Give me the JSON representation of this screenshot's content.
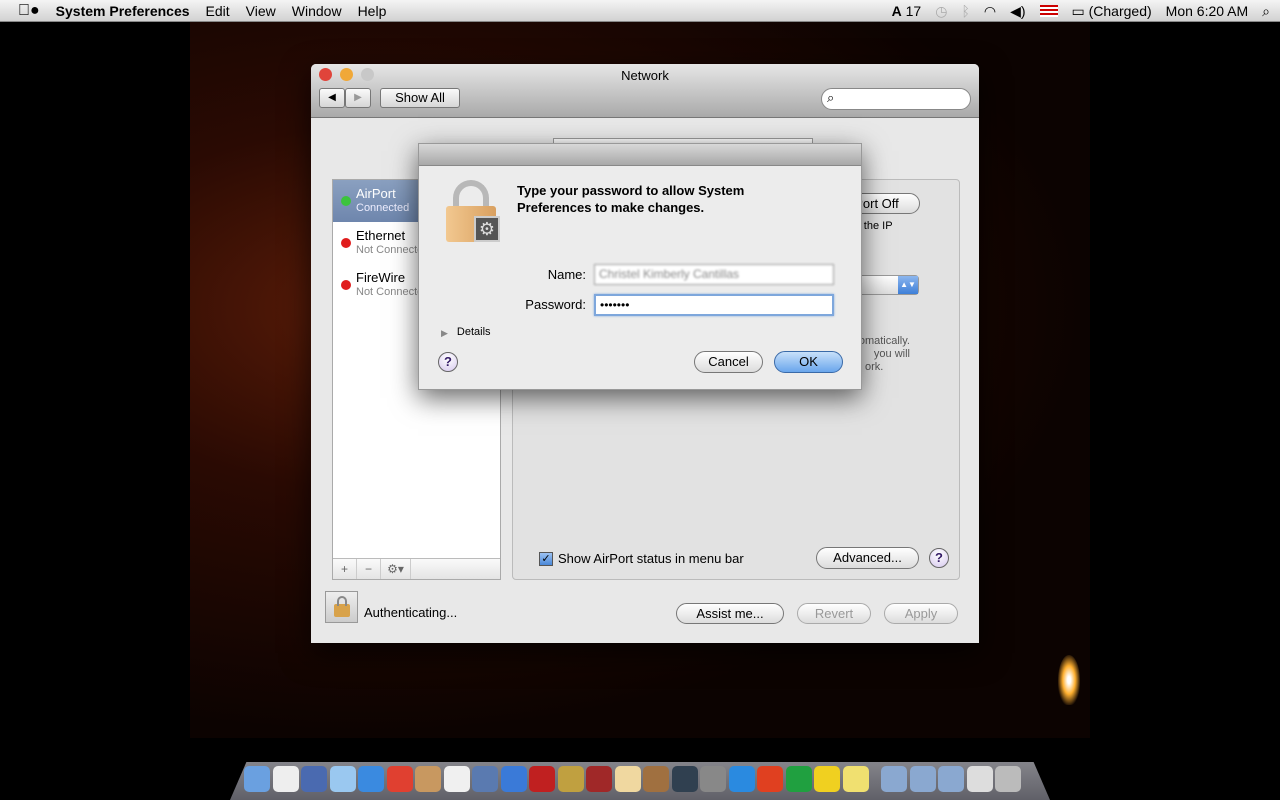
{
  "menubar": {
    "apple": "",
    "app": "System Preferences",
    "items": [
      "Edit",
      "View",
      "Window",
      "Help"
    ],
    "adobe_count": "17",
    "battery": "(Charged)",
    "clock": "Mon 6:20 AM"
  },
  "window": {
    "title": "Network",
    "show_all": "Show All",
    "search_placeholder": "",
    "services": [
      {
        "name": "AirPort",
        "status": "Connected",
        "color": "#3cc43c"
      },
      {
        "name": "Ethernet",
        "status": "Not Connected",
        "color": "#e01c1c"
      },
      {
        "name": "FireWire",
        "status": "Not Connected",
        "color": "#e01c1c"
      }
    ],
    "panel": {
      "turn_off_partial": "Port Off",
      "ip_partial": "has the IP",
      "auto_partial": [
        "omatically.",
        "you will",
        "ork."
      ],
      "show_status": "Show AirPort status in menu bar",
      "show_status_checked": true,
      "advanced": "Advanced...",
      "help": "?"
    },
    "sidebar_buttons": [
      "+",
      "−",
      "⚙▾"
    ],
    "lock_status": "Authenticating...",
    "assist": "Assist me...",
    "revert": "Revert",
    "apply": "Apply"
  },
  "sheet": {
    "message": "Type your password to allow System Preferences to make changes.",
    "name_label": "Name:",
    "name_value": "Christel Kimberly Cantillas",
    "password_label": "Password:",
    "password_value": "•••••••",
    "details": "Details",
    "help": "?",
    "cancel": "Cancel",
    "ok": "OK"
  },
  "dock": {
    "apps": [
      "Finder",
      "X11",
      "Mail",
      "Xcode",
      "Safari",
      "Chrome",
      "Address Book",
      "iCal",
      "iPhoto",
      "iTunes",
      "Photo Booth",
      "iMovie",
      "Dictionary",
      "Preview",
      "GarageBand",
      "Time Machine",
      "System Preferences",
      "Word",
      "PowerPoint",
      "Excel",
      "Messenger",
      "Stickies",
      "Applications",
      "Documents",
      "Downloads",
      "Finder Window",
      "Trash"
    ]
  }
}
